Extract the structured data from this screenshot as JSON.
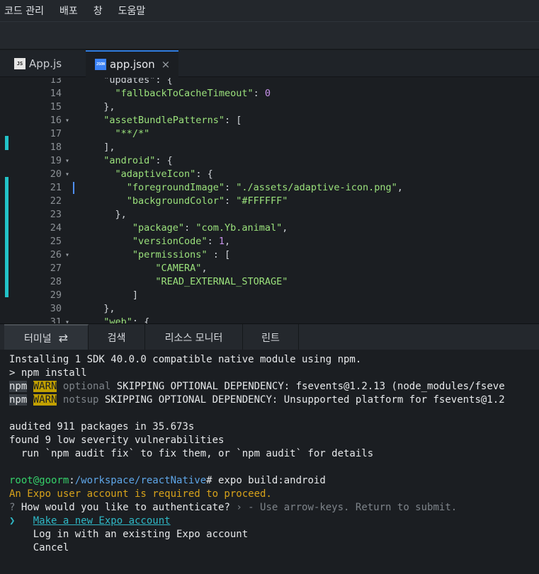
{
  "menu": [
    "코드 관리",
    "배포",
    "창",
    "도움말"
  ],
  "tabs": [
    {
      "icon": "JS",
      "label": "App.js",
      "active": false
    },
    {
      "icon": "JSON",
      "label": "app.json",
      "active": true,
      "close": "×"
    }
  ],
  "editor": {
    "lines": [
      {
        "n": "13",
        "fold": "",
        "indent": "  ",
        "html": [
          [
            "p",
            "\"updates\": {"
          ]
        ]
      },
      {
        "n": "14",
        "fold": "",
        "indent": "    ",
        "html": [
          [
            "k",
            "\"fallbackToCacheTimeout\""
          ],
          [
            "p",
            ": "
          ],
          [
            "n",
            "0"
          ]
        ]
      },
      {
        "n": "15",
        "fold": "",
        "indent": "  ",
        "html": [
          [
            "p",
            "},"
          ]
        ]
      },
      {
        "n": "16",
        "fold": "▾",
        "indent": "  ",
        "html": [
          [
            "k",
            "\"assetBundlePatterns\""
          ],
          [
            "p",
            ": ["
          ]
        ]
      },
      {
        "n": "17",
        "fold": "",
        "indent": "    ",
        "html": [
          [
            "s",
            "\"**/*\""
          ]
        ]
      },
      {
        "n": "18",
        "fold": "",
        "indent": "  ",
        "html": [
          [
            "p",
            "],"
          ]
        ]
      },
      {
        "n": "19",
        "fold": "▾",
        "indent": "  ",
        "html": [
          [
            "k",
            "\"android\""
          ],
          [
            "p",
            ": {"
          ]
        ]
      },
      {
        "n": "20",
        "fold": "▾",
        "indent": "    ",
        "html": [
          [
            "k",
            "\"adaptiveIcon\""
          ],
          [
            "p",
            ": {"
          ]
        ]
      },
      {
        "n": "21",
        "fold": "",
        "indent": "      ",
        "html": [
          [
            "k",
            "\"foregroundImage\""
          ],
          [
            "p",
            ": "
          ],
          [
            "s",
            "\"./assets/adaptive-icon.png\""
          ],
          [
            "p",
            ","
          ]
        ]
      },
      {
        "n": "22",
        "fold": "",
        "indent": "      ",
        "html": [
          [
            "k",
            "\"backgroundColor\""
          ],
          [
            "p",
            ": "
          ],
          [
            "s",
            "\"#FFFFFF\""
          ]
        ]
      },
      {
        "n": "23",
        "fold": "",
        "indent": "    ",
        "html": [
          [
            "p",
            "},"
          ]
        ]
      },
      {
        "n": "24",
        "fold": "",
        "indent": "       ",
        "html": [
          [
            "k",
            "\"package\""
          ],
          [
            "p",
            ": "
          ],
          [
            "s",
            "\"com.Yb.animal\""
          ],
          [
            "p",
            ","
          ]
        ]
      },
      {
        "n": "25",
        "fold": "",
        "indent": "       ",
        "html": [
          [
            "k",
            "\"versionCode\""
          ],
          [
            "p",
            ": "
          ],
          [
            "n",
            "1"
          ],
          [
            "p",
            ","
          ]
        ]
      },
      {
        "n": "26",
        "fold": "▾",
        "indent": "       ",
        "html": [
          [
            "k",
            "\"permissions\""
          ],
          [
            "p",
            " : ["
          ]
        ]
      },
      {
        "n": "27",
        "fold": "",
        "indent": "           ",
        "html": [
          [
            "s",
            "\"CAMERA\""
          ],
          [
            "p",
            ","
          ]
        ]
      },
      {
        "n": "28",
        "fold": "",
        "indent": "           ",
        "html": [
          [
            "s",
            "\"READ_EXTERNAL_STORAGE\""
          ]
        ]
      },
      {
        "n": "29",
        "fold": "",
        "indent": "       ",
        "html": [
          [
            "p",
            "]"
          ]
        ]
      },
      {
        "n": "30",
        "fold": "",
        "indent": "  ",
        "html": [
          [
            "p",
            "},"
          ]
        ]
      },
      {
        "n": "31",
        "fold": "▾",
        "indent": "  ",
        "html": [
          [
            "k",
            "\"web\""
          ],
          [
            "p",
            ": {"
          ]
        ]
      }
    ]
  },
  "panel_tabs": [
    {
      "label": "터미널",
      "active": true,
      "icon": "⇄"
    },
    {
      "label": "검색",
      "active": false
    },
    {
      "label": "리소스 모니터",
      "active": false
    },
    {
      "label": "린트",
      "active": false
    }
  ],
  "terminal": [
    [
      [
        "",
        "Installing 1 SDK 40.0.0 compatible native module using npm."
      ]
    ],
    [
      [
        "",
        "> npm install"
      ]
    ],
    [
      [
        "npm",
        "npm"
      ],
      [
        "",
        " "
      ],
      [
        "warn",
        "WARN"
      ],
      [
        "",
        " "
      ],
      [
        "dim",
        "optional"
      ],
      [
        "",
        " SKIPPING OPTIONAL DEPENDENCY: fsevents@1.2.13 (node_modules/fseve"
      ]
    ],
    [
      [
        "npm",
        "npm"
      ],
      [
        "",
        " "
      ],
      [
        "warn",
        "WARN"
      ],
      [
        "",
        " "
      ],
      [
        "dim",
        "notsup"
      ],
      [
        "",
        " SKIPPING OPTIONAL DEPENDENCY: Unsupported platform for fsevents@1.2"
      ]
    ],
    [
      [
        "",
        ""
      ]
    ],
    [
      [
        "",
        "audited 911 packages in 35.673s"
      ]
    ],
    [
      [
        "",
        "found 9 low severity vulnerabilities"
      ]
    ],
    [
      [
        "",
        "  run `npm audit fix` to fix them, or `npm audit` for details"
      ]
    ],
    [
      [
        "",
        ""
      ]
    ],
    [
      [
        "green",
        "root@goorm"
      ],
      [
        "",
        ":"
      ],
      [
        "blue",
        "/workspace/reactNative"
      ],
      [
        "",
        "# expo build:android"
      ]
    ],
    [
      [
        "yellow",
        "An Expo user account is required to proceed."
      ]
    ],
    [
      [
        "dim",
        "?"
      ],
      [
        "",
        " How would you like to authenticate? "
      ],
      [
        "dim",
        "› - Use arrow-keys. Return to submit."
      ]
    ],
    [
      [
        "cyan",
        "❯   "
      ],
      [
        "link",
        "Make a new Expo account"
      ]
    ],
    [
      [
        "",
        "    Log in with an existing Expo account"
      ]
    ],
    [
      [
        "",
        "    Cancel"
      ]
    ]
  ],
  "colors": {
    "accent": "#2f7bdc",
    "gutter_mark": "#22c3c8",
    "warn": "#c2a000"
  }
}
